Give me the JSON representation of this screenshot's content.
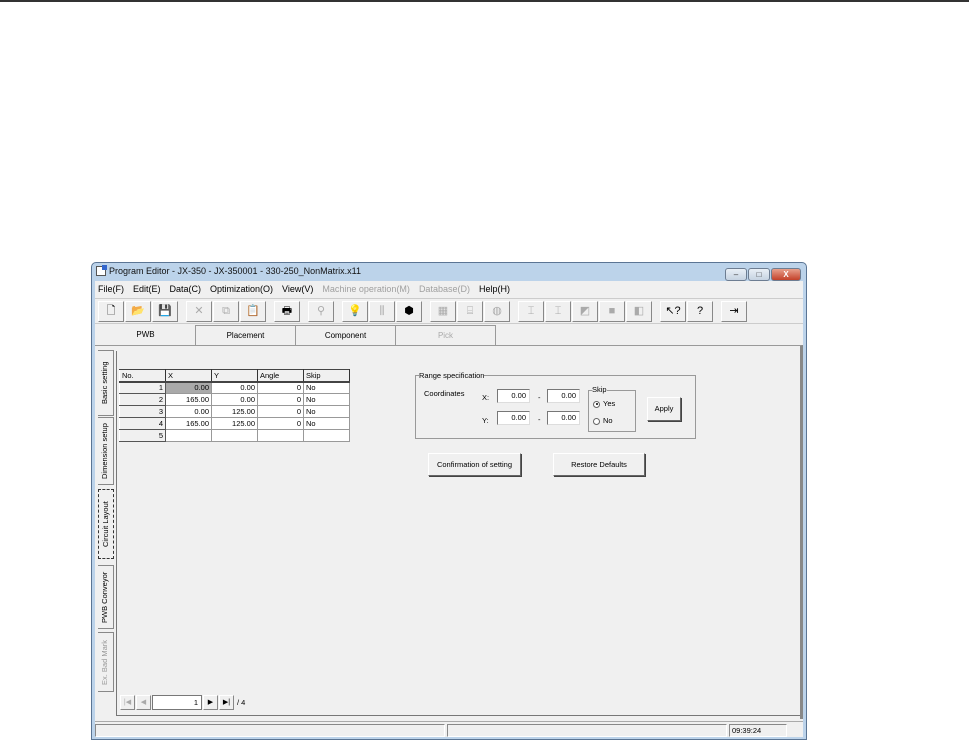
{
  "window": {
    "title": "Program Editor - JX-350 - JX-350001 - 330-250_NonMatrix.x11",
    "minimize": "–",
    "maximize": "□",
    "close": "X"
  },
  "menu": [
    {
      "label": "File(F)",
      "enabled": true
    },
    {
      "label": "Edit(E)",
      "enabled": true
    },
    {
      "label": "Data(C)",
      "enabled": true
    },
    {
      "label": "Optimization(O)",
      "enabled": true
    },
    {
      "label": "View(V)",
      "enabled": true
    },
    {
      "label": "Machine operation(M)",
      "enabled": false
    },
    {
      "label": "Database(D)",
      "enabled": false
    },
    {
      "label": "Help(H)",
      "enabled": true
    }
  ],
  "toolbar": [
    {
      "icon": "new-icon",
      "glyph": "🗋"
    },
    {
      "icon": "open-icon",
      "glyph": "📂"
    },
    {
      "icon": "save-icon",
      "glyph": "💾"
    },
    {
      "icon": "cut-icon",
      "glyph": "✕"
    },
    {
      "icon": "copy-icon",
      "glyph": "⧉"
    },
    {
      "icon": "paste-icon",
      "glyph": "📋"
    },
    {
      "icon": "print-icon",
      "glyph": "🖶"
    },
    {
      "icon": "find-icon",
      "glyph": "⚲"
    },
    {
      "icon": "lightbulb-icon",
      "glyph": "💡"
    },
    {
      "icon": "nozzle-icon",
      "glyph": "⫼"
    },
    {
      "icon": "components-icon",
      "glyph": "⬢"
    },
    {
      "icon": "grid-icon",
      "glyph": "▦"
    },
    {
      "icon": "feeder-icon",
      "glyph": "⌸"
    },
    {
      "icon": "part-icon",
      "glyph": "◍"
    },
    {
      "icon": "align-left-icon",
      "glyph": "⌶"
    },
    {
      "icon": "align-icon",
      "glyph": "⌶"
    },
    {
      "icon": "move-icon",
      "glyph": "◩"
    },
    {
      "icon": "stop-icon",
      "glyph": "■"
    },
    {
      "icon": "layers-icon",
      "glyph": "◧"
    },
    {
      "icon": "context-help-icon",
      "glyph": "↖?"
    },
    {
      "icon": "help-icon",
      "glyph": "?"
    },
    {
      "icon": "exit-icon",
      "glyph": "⇥"
    }
  ],
  "tabs": [
    {
      "label": "PWB",
      "enabled": true
    },
    {
      "label": "Placement",
      "enabled": true
    },
    {
      "label": "Component",
      "enabled": true
    },
    {
      "label": "Pick",
      "enabled": false
    }
  ],
  "side_tabs": [
    {
      "label": "Basic setting"
    },
    {
      "label": "Dimension setup"
    },
    {
      "label": "Circuit Layout"
    },
    {
      "label": "PWB Conveyor"
    },
    {
      "label": "Ex. Bad Mark"
    }
  ],
  "grid": {
    "headers": [
      "No.",
      "X",
      "Y",
      "Angle",
      "Skip"
    ],
    "rows": [
      [
        "1",
        "0.00",
        "0.00",
        "0",
        "No"
      ],
      [
        "2",
        "165.00",
        "0.00",
        "0",
        "No"
      ],
      [
        "3",
        "0.00",
        "125.00",
        "0",
        "No"
      ],
      [
        "4",
        "165.00",
        "125.00",
        "0",
        "No"
      ],
      [
        "5",
        "",
        "",
        "",
        ""
      ]
    ]
  },
  "nav": {
    "current": "1",
    "total": "/ 4"
  },
  "range": {
    "legend": "Range specification",
    "coordinates_label": "Coordinates",
    "x_label": "X:",
    "y_label": "Y:",
    "x_from": "0.00",
    "x_to": "0.00",
    "y_from": "0.00",
    "y_to": "0.00",
    "dash": "-",
    "skip_legend": "Skip",
    "yes": "Yes",
    "no": "No",
    "skip_value": "Yes",
    "apply": "Apply"
  },
  "buttons": {
    "confirm": "Confirmation of setting",
    "restore": "Restore Defaults"
  },
  "status": {
    "time": "09:39:24"
  }
}
